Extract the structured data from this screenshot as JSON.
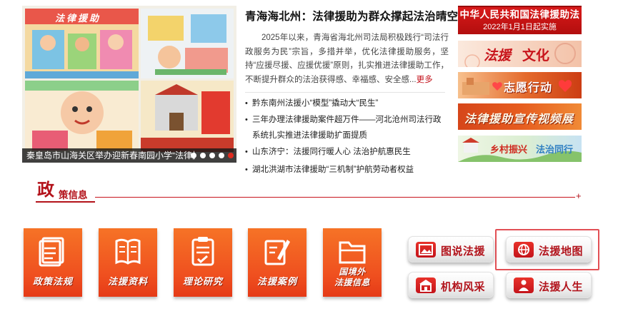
{
  "slideshow": {
    "caption": "秦皇岛市山海关区举办迎新春南园小学“法律援助”",
    "slide_count": 5,
    "active_slide": 5,
    "poster_title": "法律援助"
  },
  "headline": {
    "title": "青海海北州：法律援助为群众撑起法治晴空",
    "summary": "2025年以来，青海省海北州司法局积极践行“司法行政服务为民”宗旨，多措并举，优化法律援助服务，坚持“应援尽援、应援优援”原则，扎实推进法律援助工作，不断提升群众的法治获得感、幸福感、安全感...",
    "more_label": "更多"
  },
  "news": [
    "黔东南州法援小“模型”撬动大“民生”",
    "三年办理法律援助案件超万件——河北沧州司法行政系统扎实推进法律援助扩面提质",
    "山东济宁：法援同行暖人心 法治护航惠民生",
    "湖北洪湖市法律援助“三机制”护航劳动者权益"
  ],
  "banners": {
    "law": {
      "line1": "中华人民共和国法律援助法",
      "line2": "2022年1月1日起实施"
    },
    "culture": {
      "big": "法援",
      "small": "文化"
    },
    "volunteer": {
      "text": "志愿行动"
    },
    "video": {
      "text": "法律援助宣传视频展播"
    },
    "rural": {
      "part1": "乡村振兴",
      "part2": "法治同行"
    }
  },
  "section": {
    "big": "政",
    "small": "策信息",
    "more": "+"
  },
  "categories": [
    {
      "label": "政策法规",
      "icon": "document-stack-icon"
    },
    {
      "label": "法援资料",
      "icon": "book-icon"
    },
    {
      "label": "理论研究",
      "icon": "clipboard-check-icon"
    },
    {
      "label": "法援案例",
      "icon": "edit-note-icon"
    },
    {
      "label_line1": "国境外",
      "label_line2": "法援信息",
      "icon": "folder-icon"
    }
  ],
  "buttons": [
    {
      "label": "图说法援",
      "icon": "picture-icon"
    },
    {
      "label": "法援地图",
      "icon": "globe-icon"
    },
    {
      "label": "机构风采",
      "icon": "building-icon"
    },
    {
      "label": "法援人生",
      "icon": "person-icon"
    }
  ],
  "colors": {
    "brand_red": "#b3121a",
    "tile_orange": "#ef4f1f",
    "highlight": "#e25055"
  }
}
